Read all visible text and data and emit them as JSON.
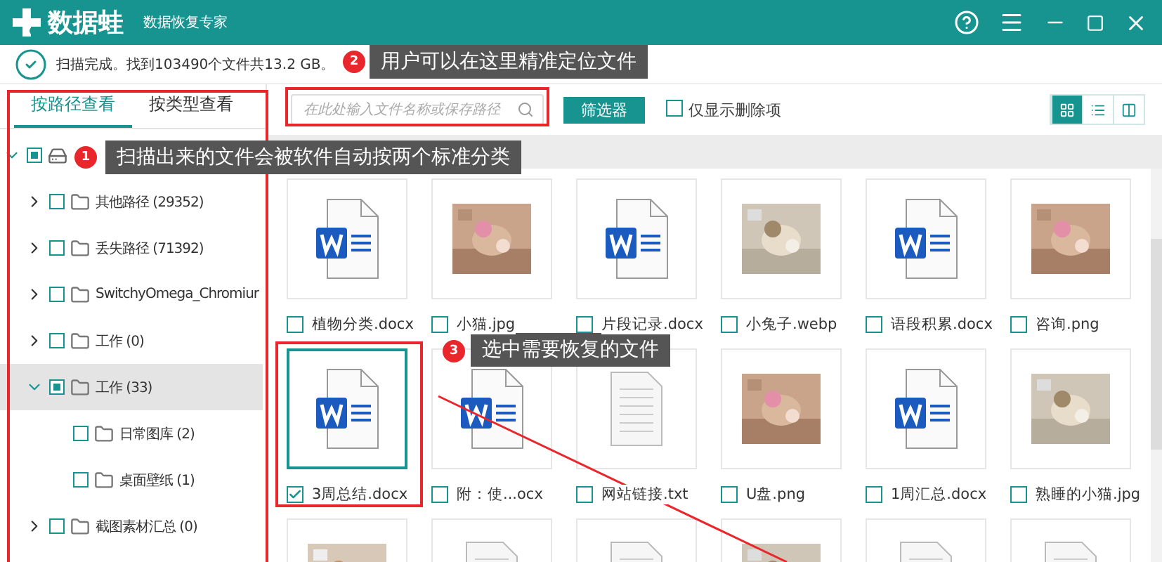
{
  "window": {
    "logo": "数据蛙",
    "subtitle": "数据恢复专家"
  },
  "status": {
    "text": "扫描完成。找到103490个文件共13.2 GB。"
  },
  "view_tabs": [
    {
      "label": "按路径查看",
      "selected": true
    },
    {
      "label": "按类型查看",
      "selected": false
    }
  ],
  "tree": [
    {
      "kind": "drive",
      "expanded": true,
      "checked": false,
      "partial": true,
      "selected": false,
      "children": [
        {
          "label": "其他路径 (29352)",
          "expanded": false,
          "checked": false,
          "partial": false,
          "selected": false
        },
        {
          "label": "丢失路径 (71392)",
          "expanded": false,
          "checked": false,
          "partial": false,
          "selected": false
        },
        {
          "label": "SwitchyOmega_Chromiur",
          "expanded": false,
          "checked": false,
          "partial": false,
          "selected": false
        },
        {
          "label": "工作 (0)",
          "expanded": false,
          "checked": false,
          "partial": false,
          "selected": false
        },
        {
          "label": "工作 (33)",
          "expanded": true,
          "checked": false,
          "partial": true,
          "selected": true,
          "children": [
            {
              "label": "日常图库 (2)",
              "checked": false,
              "partial": false,
              "selected": false
            },
            {
              "label": "桌面壁纸 (1)",
              "checked": false,
              "partial": false,
              "selected": false
            }
          ]
        },
        {
          "label": "截图素材汇总 (0)",
          "expanded": false,
          "checked": false,
          "partial": false,
          "selected": false
        }
      ]
    }
  ],
  "toolbar": {
    "search": {
      "placeholder": "在此处输入文件名称或保存路径"
    },
    "filter_button": "筛选器",
    "deleted_only": {
      "label": "仅显示删除项",
      "checked": false
    },
    "view_modes": [
      {
        "kind": "grid",
        "selected": true
      },
      {
        "kind": "list",
        "selected": false
      },
      {
        "kind": "columns",
        "selected": false
      }
    ]
  },
  "files": [
    {
      "kind": "word",
      "name": "植物分类.docx",
      "checked": false,
      "selected": false
    },
    {
      "kind": "picture",
      "name": "小猫.jpg",
      "checked": false,
      "selected": false
    },
    {
      "kind": "word",
      "name": "片段记录.docx",
      "checked": false,
      "selected": false
    },
    {
      "kind": "picture",
      "name": "小兔子.webp",
      "checked": false,
      "selected": false
    },
    {
      "kind": "word",
      "name": "语段积累.docx",
      "checked": false,
      "selected": false
    },
    {
      "kind": "picture",
      "name": "咨询.png",
      "checked": false,
      "selected": false
    },
    {
      "kind": "word",
      "name": "3周总结.docx",
      "checked": true,
      "selected": true
    },
    {
      "kind": "word",
      "name": "附：使...ocx",
      "checked": false,
      "selected": false
    },
    {
      "kind": "text",
      "name": "网站链接.txt",
      "checked": false,
      "selected": false
    },
    {
      "kind": "picture",
      "name": "U盘.png",
      "checked": false,
      "selected": false
    },
    {
      "kind": "word",
      "name": "1周汇总.docx",
      "checked": false,
      "selected": false
    },
    {
      "kind": "picture",
      "name": "熟睡的小猫.jpg",
      "checked": false,
      "selected": false
    },
    {
      "kind": "picture",
      "selected": false
    },
    {
      "kind": "text",
      "selected": false
    },
    {
      "kind": "text",
      "selected": false
    },
    {
      "kind": "picture",
      "selected": false
    },
    {
      "kind": "text",
      "selected": false
    },
    {
      "kind": "text",
      "selected": false
    }
  ],
  "annotations": [
    {
      "number": "2",
      "text": "用户可以在这里精准定位文件"
    },
    {
      "number": "1",
      "text": "扫描出来的文件会被软件自动按两个标准分类"
    },
    {
      "number": "3",
      "text": "选中需要恢复的文件"
    }
  ]
}
